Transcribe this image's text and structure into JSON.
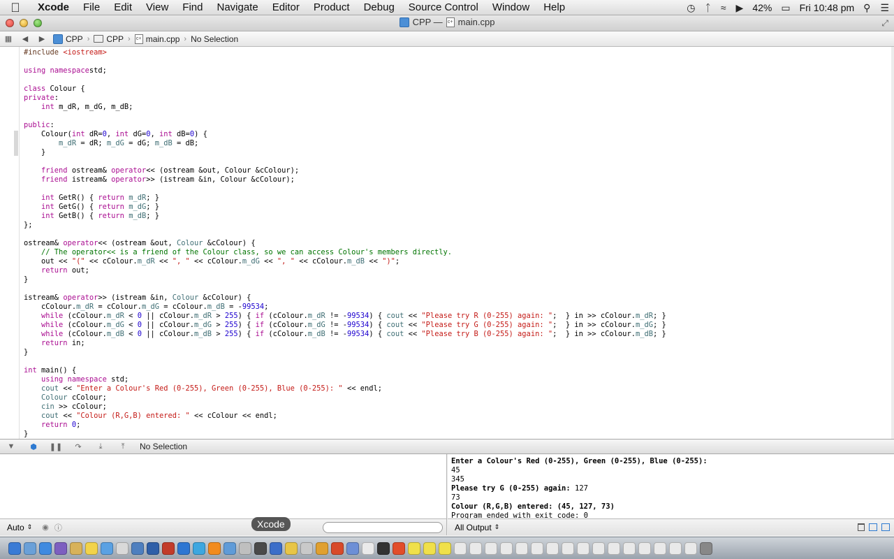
{
  "menubar": {
    "app": "Xcode",
    "items": [
      "File",
      "Edit",
      "View",
      "Find",
      "Navigate",
      "Editor",
      "Product",
      "Debug",
      "Source Control",
      "Window",
      "Help"
    ],
    "battery": "42%",
    "clock": "Fri 10:48 pm"
  },
  "window": {
    "title_project": "CPP —",
    "title_file": "main.cpp"
  },
  "jumpbar": {
    "crumbs": [
      "CPP",
      "CPP",
      "main.cpp",
      "No Selection"
    ]
  },
  "editor": {
    "lines": [
      [
        [
          "pp",
          "#include "
        ],
        [
          "str",
          "<iostream>"
        ]
      ],
      [],
      [
        [
          "kw",
          "using namespace"
        ],
        [
          "",
          "std;"
        ]
      ],
      [],
      [
        [
          "kw",
          "class"
        ],
        [
          "",
          " Colour {"
        ]
      ],
      [
        [
          "kw",
          "private"
        ],
        [
          "",
          ":"
        ]
      ],
      [
        [
          "",
          "    "
        ],
        [
          "kw",
          "int"
        ],
        [
          "",
          " m_dR, m_dG, m_dB;"
        ]
      ],
      [],
      [
        [
          "kw",
          "public"
        ],
        [
          "",
          ":"
        ]
      ],
      [
        [
          "",
          "    Colour("
        ],
        [
          "kw",
          "int"
        ],
        [
          "",
          " dR="
        ],
        [
          "num",
          "0"
        ],
        [
          "",
          ", "
        ],
        [
          "kw",
          "int"
        ],
        [
          "",
          " dG="
        ],
        [
          "num",
          "0"
        ],
        [
          "",
          ", "
        ],
        [
          "kw",
          "int"
        ],
        [
          "",
          " dB="
        ],
        [
          "num",
          "0"
        ],
        [
          "",
          ") {"
        ]
      ],
      [
        [
          "",
          "        "
        ],
        [
          "mem",
          "m_dR"
        ],
        [
          "",
          " = dR; "
        ],
        [
          "mem",
          "m_dG"
        ],
        [
          "",
          " = dG; "
        ],
        [
          "mem",
          "m_dB"
        ],
        [
          "",
          " = dB;"
        ]
      ],
      [
        [
          "",
          "    }"
        ]
      ],
      [],
      [
        [
          "",
          "    "
        ],
        [
          "kw",
          "friend"
        ],
        [
          "",
          " ostream& "
        ],
        [
          "kw",
          "operator"
        ],
        [
          "",
          "<< (ostream &out, Colour &cColour);"
        ]
      ],
      [
        [
          "",
          "    "
        ],
        [
          "kw",
          "friend"
        ],
        [
          "",
          " istream& "
        ],
        [
          "kw",
          "operator"
        ],
        [
          "",
          ">> (istream &in, Colour &cColour);"
        ]
      ],
      [],
      [
        [
          "",
          "    "
        ],
        [
          "kw",
          "int"
        ],
        [
          "",
          " GetR() { "
        ],
        [
          "kw",
          "return"
        ],
        [
          "",
          " "
        ],
        [
          "mem",
          "m_dR"
        ],
        [
          "",
          "; }"
        ]
      ],
      [
        [
          "",
          "    "
        ],
        [
          "kw",
          "int"
        ],
        [
          "",
          " GetG() { "
        ],
        [
          "kw",
          "return"
        ],
        [
          "",
          " "
        ],
        [
          "mem",
          "m_dG"
        ],
        [
          "",
          "; }"
        ]
      ],
      [
        [
          "",
          "    "
        ],
        [
          "kw",
          "int"
        ],
        [
          "",
          " GetB() { "
        ],
        [
          "kw",
          "return"
        ],
        [
          "",
          " "
        ],
        [
          "mem",
          "m_dB"
        ],
        [
          "",
          "; }"
        ]
      ],
      [
        [
          "",
          "};"
        ]
      ],
      [],
      [
        [
          "",
          "ostream& "
        ],
        [
          "kw",
          "operator"
        ],
        [
          "",
          "<< (ostream &out, "
        ],
        [
          "mem",
          "Colour"
        ],
        [
          "",
          " &cColour) {"
        ]
      ],
      [
        [
          "",
          "    "
        ],
        [
          "cmt",
          "// The operator<< is a friend of the Colour class, so we can access Colour's members directly."
        ]
      ],
      [
        [
          "",
          "    out << "
        ],
        [
          "str",
          "\"(\""
        ],
        [
          "",
          " << cColour."
        ],
        [
          "mem",
          "m_dR"
        ],
        [
          "",
          " << "
        ],
        [
          "str",
          "\", \""
        ],
        [
          "",
          " << cColour."
        ],
        [
          "mem",
          "m_dG"
        ],
        [
          "",
          " << "
        ],
        [
          "str",
          "\", \""
        ],
        [
          "",
          " << cColour."
        ],
        [
          "mem",
          "m_dB"
        ],
        [
          "",
          " << "
        ],
        [
          "str",
          "\")\""
        ],
        [
          "",
          ";"
        ]
      ],
      [
        [
          "",
          "    "
        ],
        [
          "kw",
          "return"
        ],
        [
          "",
          " out;"
        ]
      ],
      [
        [
          "",
          "}"
        ]
      ],
      [],
      [
        [
          "",
          "istream& "
        ],
        [
          "kw",
          "operator"
        ],
        [
          "",
          ">> (istream &in, "
        ],
        [
          "mem",
          "Colour"
        ],
        [
          "",
          " &cColour) {"
        ]
      ],
      [
        [
          "",
          "    cColour."
        ],
        [
          "mem",
          "m_dR"
        ],
        [
          "",
          " = cColour."
        ],
        [
          "mem",
          "m_dG"
        ],
        [
          "",
          " = cColour."
        ],
        [
          "mem",
          "m_dB"
        ],
        [
          "",
          " = -"
        ],
        [
          "num",
          "99534"
        ],
        [
          "",
          ";"
        ]
      ],
      [
        [
          "",
          "    "
        ],
        [
          "kw",
          "while"
        ],
        [
          "",
          " (cColour."
        ],
        [
          "mem",
          "m_dR"
        ],
        [
          "",
          " < "
        ],
        [
          "num",
          "0"
        ],
        [
          "",
          " || cColour."
        ],
        [
          "mem",
          "m_dR"
        ],
        [
          "",
          " > "
        ],
        [
          "num",
          "255"
        ],
        [
          "",
          ") { "
        ],
        [
          "kw",
          "if"
        ],
        [
          "",
          " (cColour."
        ],
        [
          "mem",
          "m_dR"
        ],
        [
          "",
          " != -"
        ],
        [
          "num",
          "99534"
        ],
        [
          "",
          ") { "
        ],
        [
          "mem",
          "cout"
        ],
        [
          "",
          " << "
        ],
        [
          "str",
          "\"Please try R (0-255) again: \""
        ],
        [
          "",
          ";  } in >> cColour."
        ],
        [
          "mem",
          "m_dR"
        ],
        [
          "",
          "; }"
        ]
      ],
      [
        [
          "",
          "    "
        ],
        [
          "kw",
          "while"
        ],
        [
          "",
          " (cColour."
        ],
        [
          "mem",
          "m_dG"
        ],
        [
          "",
          " < "
        ],
        [
          "num",
          "0"
        ],
        [
          "",
          " || cColour."
        ],
        [
          "mem",
          "m_dG"
        ],
        [
          "",
          " > "
        ],
        [
          "num",
          "255"
        ],
        [
          "",
          ") { "
        ],
        [
          "kw",
          "if"
        ],
        [
          "",
          " (cColour."
        ],
        [
          "mem",
          "m_dG"
        ],
        [
          "",
          " != -"
        ],
        [
          "num",
          "99534"
        ],
        [
          "",
          ") { "
        ],
        [
          "mem",
          "cout"
        ],
        [
          "",
          " << "
        ],
        [
          "str",
          "\"Please try G (0-255) again: \""
        ],
        [
          "",
          ";  } in >> cColour."
        ],
        [
          "mem",
          "m_dG"
        ],
        [
          "",
          "; }"
        ]
      ],
      [
        [
          "",
          "    "
        ],
        [
          "kw",
          "while"
        ],
        [
          "",
          " (cColour."
        ],
        [
          "mem",
          "m_dB"
        ],
        [
          "",
          " < "
        ],
        [
          "num",
          "0"
        ],
        [
          "",
          " || cColour."
        ],
        [
          "mem",
          "m_dB"
        ],
        [
          "",
          " > "
        ],
        [
          "num",
          "255"
        ],
        [
          "",
          ") { "
        ],
        [
          "kw",
          "if"
        ],
        [
          "",
          " (cColour."
        ],
        [
          "mem",
          "m_dB"
        ],
        [
          "",
          " != -"
        ],
        [
          "num",
          "99534"
        ],
        [
          "",
          ") { "
        ],
        [
          "mem",
          "cout"
        ],
        [
          "",
          " << "
        ],
        [
          "str",
          "\"Please try B (0-255) again: \""
        ],
        [
          "",
          ";  } in >> cColour."
        ],
        [
          "mem",
          "m_dB"
        ],
        [
          "",
          "; }"
        ]
      ],
      [
        [
          "",
          "    "
        ],
        [
          "kw",
          "return"
        ],
        [
          "",
          " in;"
        ]
      ],
      [
        [
          "",
          "}"
        ]
      ],
      [],
      [
        [
          "kw",
          "int"
        ],
        [
          "",
          " main() {"
        ]
      ],
      [
        [
          "",
          "    "
        ],
        [
          "kw",
          "using namespace"
        ],
        [
          "",
          " std;"
        ]
      ],
      [
        [
          "",
          "    "
        ],
        [
          "mem",
          "cout"
        ],
        [
          "",
          " << "
        ],
        [
          "str",
          "\"Enter a Colour's Red (0-255), Green (0-255), Blue (0-255): \""
        ],
        [
          "",
          " << endl;"
        ]
      ],
      [
        [
          "",
          "    "
        ],
        [
          "mem",
          "Colour"
        ],
        [
          "",
          " cColour;"
        ]
      ],
      [
        [
          "",
          "    "
        ],
        [
          "mem",
          "cin"
        ],
        [
          "",
          " >> cColour;"
        ]
      ],
      [
        [
          "",
          "    "
        ],
        [
          "mem",
          "cout"
        ],
        [
          "",
          " << "
        ],
        [
          "str",
          "\"Colour (R,G,B) entered: \""
        ],
        [
          "",
          " << cColour << endl;"
        ]
      ],
      [
        [
          "",
          "    "
        ],
        [
          "kw",
          "return"
        ],
        [
          "",
          " "
        ],
        [
          "num",
          "0"
        ],
        [
          "",
          ";"
        ]
      ],
      [
        [
          "",
          "}"
        ]
      ]
    ]
  },
  "debugbar": {
    "selection": "No Selection"
  },
  "console": {
    "lines": [
      {
        "text": "Enter a Colour's Red (0-255), Green (0-255), Blue (0-255):",
        "bold": true
      },
      {
        "text": "45",
        "bold": false
      },
      {
        "text": "345",
        "bold": false
      },
      {
        "text": "Please try G (0-255) again: ",
        "bold": true,
        "rest": "127"
      },
      {
        "text": "73",
        "bold": false
      },
      {
        "text": "Colour (R,G,B) entered: (45, 127, 73)",
        "bold": true
      },
      {
        "text": "Program ended with exit code: 0",
        "bold": false
      }
    ]
  },
  "footer": {
    "variables_scope": "Auto",
    "output_scope": "All Output"
  },
  "tooltip": "Xcode",
  "dock": {
    "colors": [
      "#3a7bd5",
      "#6aa0d8",
      "#3f8ae0",
      "#7d5fc0",
      "#d8b25a",
      "#f2d34a",
      "#5aa1e3",
      "#d9d9d9",
      "#4e7fbf",
      "#2f5fa8",
      "#c23b2a",
      "#2d76d2",
      "#3da7e0",
      "#f28b1e",
      "#5f9bd8",
      "#bfbfbf",
      "#4a4a4a",
      "#3b6ec9",
      "#e8c547",
      "#c9c9c9",
      "#e0a030",
      "#d84a2a",
      "#6d8fd6",
      "#eaeaea",
      "#333333",
      "#e24d2a",
      "#f0e04a",
      "#f0e04a",
      "#f0e04a",
      "#e9e9e9",
      "#e9e9e9",
      "#e9e9e9",
      "#e9e9e9",
      "#e9e9e9",
      "#e9e9e9",
      "#e9e9e9",
      "#e9e9e9",
      "#e9e9e9",
      "#e9e9e9",
      "#e9e9e9",
      "#e9e9e9",
      "#e9e9e9",
      "#e9e9e9",
      "#e9e9e9",
      "#e9e9e9",
      "#888888"
    ]
  }
}
